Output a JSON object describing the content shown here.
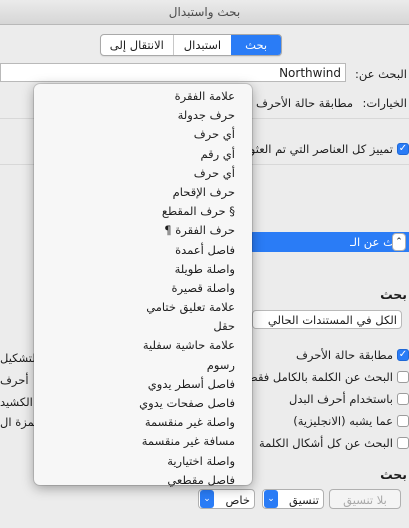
{
  "window": {
    "title": "بحث واستبدال"
  },
  "tabs": [
    {
      "label": "بحث"
    },
    {
      "label": "استبدال"
    },
    {
      "label": "الانتقال إلى"
    }
  ],
  "search": {
    "label": "البحث عن:",
    "value": "Northwind"
  },
  "options": {
    "label": "الخيارات:",
    "value": "مطابقة حالة الأحرف"
  },
  "highlight_all": {
    "label": "تمييز كل العناصر التي تم العثور"
  },
  "find_in_button": {
    "label": "بحث عن الـ"
  },
  "section_search": {
    "label": "بحث"
  },
  "scope_dropdown": {
    "value": "الكل في المستندات الحالي"
  },
  "checkboxes": [
    {
      "label": "مطابقة حالة الأحرف",
      "checked": true
    },
    {
      "label": "البحث عن الكلمة بالكامل فقط",
      "checked": false
    },
    {
      "label": "باستخدام أحرف البدل",
      "checked": false
    },
    {
      "label": "عما يشبه (الانجليزية)",
      "checked": false
    },
    {
      "label": "البحث عن كل أشكال الكلمة",
      "checked": false
    }
  ],
  "right_checkboxes": [
    {
      "label": "التشكيل"
    },
    {
      "label": "أحرف"
    },
    {
      "label": "الكشيد"
    },
    {
      "label": "همزة ال"
    }
  ],
  "section_replace": {
    "label": "بحث"
  },
  "bottom": {
    "no_format_button": "بلا تنسيق",
    "format_button": "تنسيق",
    "special_button": "خاص"
  },
  "special_menu": [
    "علامة الفقرة",
    "حرف جدولة",
    "أي حرف",
    "أي رقم",
    "أي حرف",
    "حرف الإقحام",
    "§ حرف المقطع",
    "حرف الفقرة ¶",
    "فاصل أعمدة",
    "واصلة طويلة",
    "واصلة قصيرة",
    "علامة تعليق ختامي",
    "حقل",
    "علامة حاشية سفلية",
    "رسوم",
    "فاصل أسطر يدوي",
    "فاصل صفحات يدوي",
    "واصلة غير منقسمة",
    "مسافة غير منقسمة",
    "واصلة اختيارية",
    "فاصل مقطعي"
  ],
  "colors": {
    "accent": "#2a7cf6",
    "background": "#ececec"
  }
}
